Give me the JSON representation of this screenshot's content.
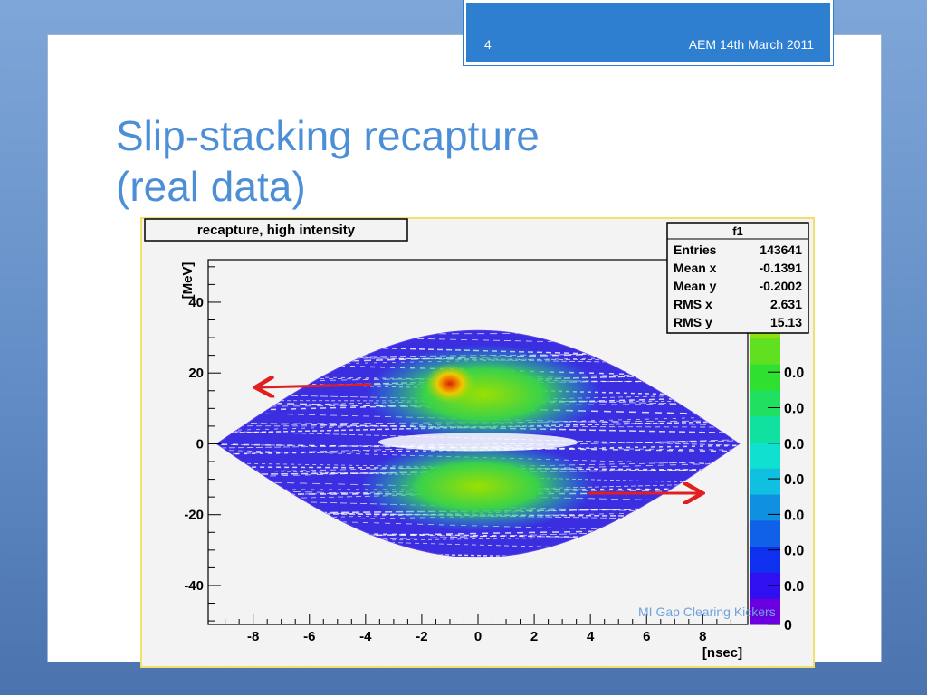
{
  "header": {
    "slide_number": "4",
    "date": "AEM 14th March 2011"
  },
  "title": {
    "line1": "Slip-stacking recapture",
    "line2": "(real data)"
  },
  "footer": "MI Gap Clearing Kickers",
  "chart_data": {
    "type": "heatmap",
    "title": "recapture, high intensity",
    "xlabel": "[nsec]",
    "ylabel": "[MeV]",
    "xlim": [
      -9.6,
      9.6
    ],
    "ylim": [
      -51,
      52
    ],
    "xticks": [
      "-8",
      "-6",
      "-4",
      "-2",
      "0",
      "2",
      "4",
      "6",
      "8"
    ],
    "xtick_values": [
      -8,
      -6,
      -4,
      -2,
      0,
      2,
      4,
      6,
      8
    ],
    "yticks": [
      "40",
      "20",
      "0",
      "-20",
      "-40"
    ],
    "ytick_values": [
      40,
      20,
      0,
      -20,
      -40
    ],
    "colorbar_labels": [
      "0.0",
      "0.0",
      "0.0",
      "0.0",
      "0.0",
      "0.0",
      "0.0",
      "0"
    ],
    "stats": {
      "name": "f1",
      "rows": [
        [
          "Entries",
          "143641"
        ],
        [
          "Mean x",
          "-0.1391"
        ],
        [
          "Mean y",
          "-0.2002"
        ],
        [
          "RMS x",
          "2.631"
        ],
        [
          "RMS y",
          "15.13"
        ]
      ]
    },
    "separatrix_half_length_ns": 9.3,
    "separatrix_height_MeV": 32,
    "annotations": [
      {
        "type": "arrow",
        "direction": "left",
        "y_MeV": 17
      },
      {
        "type": "arrow",
        "direction": "right",
        "y_MeV": -14
      }
    ]
  }
}
